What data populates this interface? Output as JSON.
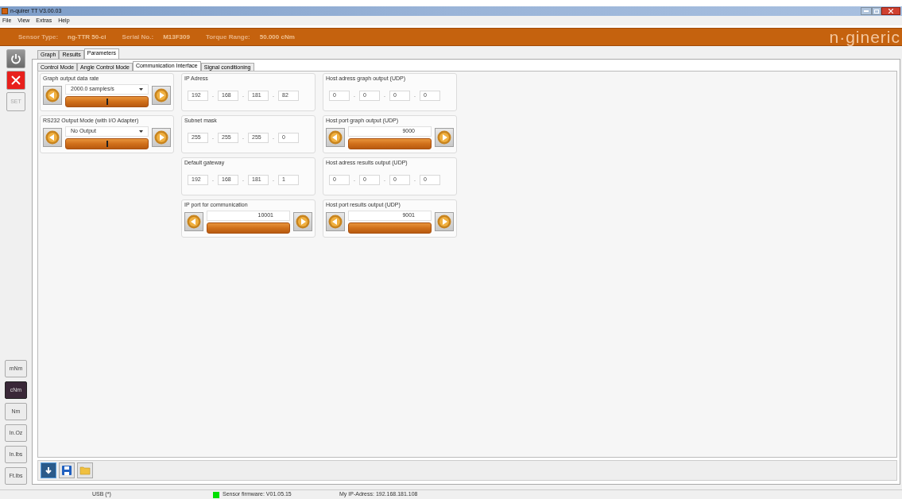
{
  "window": {
    "title": "n-quirer TT V3.00.03"
  },
  "menu": [
    "File",
    "View",
    "Extras",
    "Help"
  ],
  "header": {
    "fields": [
      {
        "label": "Sensor Type:",
        "value": "ng-TTR 50-ci"
      },
      {
        "label": "Serial No.:",
        "value": "M13F309"
      },
      {
        "label": "Torque Range:",
        "value": "50.000 cNm"
      }
    ],
    "logo": "n·gineric"
  },
  "side_buttons": [
    {
      "kind": "power"
    },
    {
      "kind": "cancel"
    },
    {
      "kind": "text",
      "label": "SET",
      "disabled": true
    }
  ],
  "unit_buttons": [
    {
      "label": "mNm",
      "selected": false
    },
    {
      "label": "cNm",
      "selected": true
    },
    {
      "label": "Nm",
      "selected": false
    },
    {
      "label": "In.Oz",
      "selected": false
    },
    {
      "label": "In.lbs",
      "selected": false
    },
    {
      "label": "Ft.lbs",
      "selected": false
    }
  ],
  "tabs": [
    {
      "label": "Graph",
      "selected": false
    },
    {
      "label": "Results",
      "selected": false
    },
    {
      "label": "Parameters",
      "selected": true
    }
  ],
  "subtabs": [
    {
      "label": "Control Mode",
      "selected": false
    },
    {
      "label": "Angle Control Mode",
      "selected": false
    },
    {
      "label": "Communication Interface",
      "selected": true
    },
    {
      "label": "Signal conditioning",
      "selected": false
    }
  ],
  "columns": [
    [
      {
        "kind": "select",
        "title": "Graph output data rate",
        "value": "2000.0 samples/s",
        "level": 0.5
      },
      {
        "kind": "select",
        "title": "RS232 Output Mode (with I/O Adapter)",
        "value": "No Output",
        "level": 0.5
      }
    ],
    [
      {
        "kind": "ip",
        "title": "IP Adress",
        "octets": [
          "192",
          "168",
          "181",
          "82"
        ],
        "separator": "."
      },
      {
        "kind": "ip",
        "title": "Subnet mask",
        "octets": [
          "255",
          "255",
          "255",
          "0"
        ],
        "separator": "."
      },
      {
        "kind": "ip",
        "title": "Default gateway",
        "octets": [
          "192",
          "168",
          "181",
          "1"
        ],
        "separator": "."
      },
      {
        "kind": "port",
        "title": "IP port for communication",
        "value": "10001"
      }
    ],
    [
      {
        "kind": "ip",
        "title": "Host adress graph output (UDP)",
        "octets": [
          "0",
          "0",
          "0",
          "0"
        ],
        "separator": "."
      },
      {
        "kind": "port",
        "title": "Host port graph output (UDP)",
        "value": "9000"
      },
      {
        "kind": "ip",
        "title": "Host adress results output (UDP)",
        "octets": [
          "0",
          "0",
          "0",
          "0"
        ],
        "separator": "."
      },
      {
        "kind": "port",
        "title": "Host port results output (UDP)",
        "value": "9001"
      }
    ]
  ],
  "status_bar": {
    "connection": "USB (*)",
    "firmware": "Sensor firmware: V01.05.15",
    "firmware_ok": true,
    "ip": "My IP-Adress: 192.168.181.108"
  }
}
